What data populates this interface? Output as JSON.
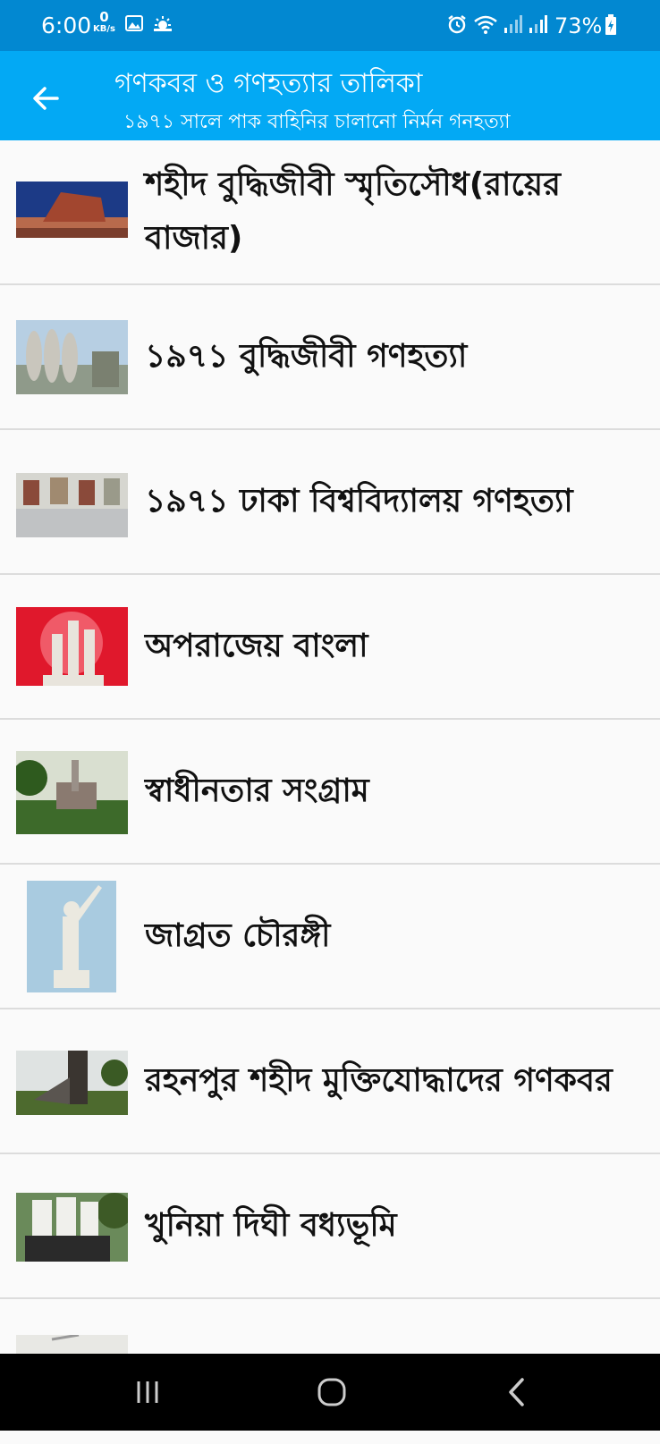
{
  "status_bar": {
    "time": "6:00",
    "net_speed_value": "0",
    "net_speed_unit": "KB/s",
    "battery": "73%",
    "icons": [
      "gallery-icon",
      "weather-icon",
      "alarm-icon",
      "wifi-icon",
      "signal-icon",
      "signal-icon",
      "battery-icon"
    ]
  },
  "app_bar": {
    "back_icon": "arrow-left-icon",
    "title": "গণকবর ও গণহত্যার তালিকা",
    "subtitle": "১৯৭১  সালে পাক বাহিনির চালানো নির্মন গনহত্যা"
  },
  "items": [
    {
      "label": "শহীদ বুদ্ধিজীবী স্মৃতিসৌধ(রায়ের বাজার)"
    },
    {
      "label": "১৯৭১ বুদ্ধিজীবী গণহত্যা"
    },
    {
      "label": "১৯৭১ ঢাকা বিশ্ববিদ্যালয় গণহত্যা"
    },
    {
      "label": "অপরাজেয় বাংলা"
    },
    {
      "label": "স্বাধীনতার সংগ্রাম"
    },
    {
      "label": "জাগ্রত চৌরঙ্গী"
    },
    {
      "label": "রহনপুর শহীদ মুক্তিযোদ্ধাদের গণকবর"
    },
    {
      "label": "খুনিয়া দিঘী বধ্যভূমি"
    },
    {
      "label": ""
    }
  ],
  "nav_bar": {
    "icons": [
      "recent-apps-icon",
      "home-icon",
      "back-nav-icon"
    ]
  }
}
